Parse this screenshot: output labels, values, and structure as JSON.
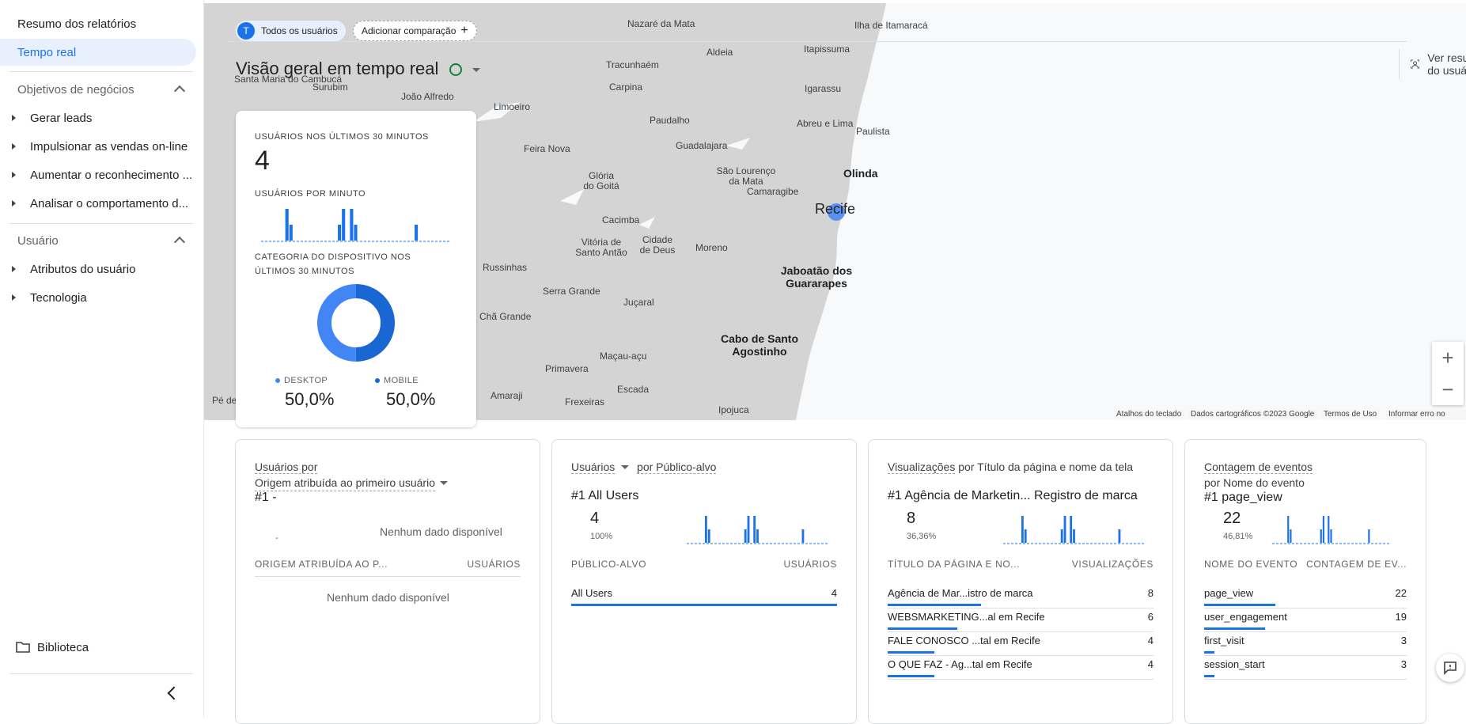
{
  "sidebar": {
    "summary": "Resumo dos relatórios",
    "realtime": "Tempo real",
    "section_business": "Objetivos de negócios",
    "business_items": [
      "Gerar leads",
      "Impulsionar as vendas on-line",
      "Aumentar o reconhecimento ...",
      "Analisar o comportamento d..."
    ],
    "section_user": "Usuário",
    "user_items": [
      "Atributos do usuário",
      "Tecnologia"
    ],
    "library": "Biblioteca"
  },
  "toolbar": {
    "all_users_avatar": "T",
    "all_users": "Todos os usuários",
    "add_comparison": "Adicionar comparação",
    "page_title": "Visão geral em tempo real",
    "user_summary": "Ver resumo do usuário"
  },
  "map": {
    "places": [
      "Ilha de Itamaracá",
      "Nazaré da Mata",
      "Aldeia",
      "Itapissuma",
      "Tracunhaém",
      "Igarassu",
      "Santa Maria do Cambucá",
      "Surubim",
      "João Alfredo",
      "Carpina",
      "Limoeiro",
      "Paudalho",
      "Abreu e Lima",
      "Paulista",
      "Feira Nova",
      "Guadalajara",
      "Olinda",
      "Glória do Goitá",
      "São Lourenço da Mata",
      "Camaragibe",
      "Recife",
      "Cacimba",
      "Vitória de Santo Antão",
      "Cidade de Deus",
      "Moreno",
      "Jaboatão dos Guararapes",
      "Russinhas",
      "Serra Grande",
      "Juçaral",
      "Chã Grande",
      "Cabo de Santo Agostinho",
      "Maçau-açu",
      "Primavera",
      "Escada",
      "Amaraji",
      "Frexeiras",
      "Ipojuca",
      "Pé de"
    ],
    "footer": [
      "Atalhos do teclado",
      "Dados cartográficos ©2023 Google",
      "Termos de Uso",
      "Informar erro no mapa"
    ],
    "zoom_in": "+",
    "zoom_out": "−"
  },
  "realtime_card": {
    "users_label": "USUÁRIOS NOS ÚLTIMOS 30 MINUTOS",
    "users_value": "4",
    "per_minute_label": "USUÁRIOS POR MINUTO",
    "per_minute_values": [
      0,
      0,
      0,
      0,
      0,
      0,
      1,
      0.5,
      0,
      0,
      0,
      0,
      0,
      0,
      0,
      0,
      0,
      0,
      0,
      0.5,
      1,
      0,
      1,
      0.5,
      0,
      0,
      0,
      0,
      0,
      0,
      0,
      0,
      0,
      0,
      0,
      0,
      0,
      0,
      0.5,
      0,
      0,
      0,
      0,
      0,
      0,
      0,
      0
    ],
    "device_label": "CATEGORIA DO DISPOSITIVO NOS ÚLTIMOS 30 MINUTOS",
    "device": [
      {
        "name": "DESKTOP",
        "value": "50,0%",
        "color": "#4285f4"
      },
      {
        "name": "MOBILE",
        "value": "50,0%",
        "color": "#1967d2"
      }
    ]
  },
  "cards": [
    {
      "title_1": "Usuários por",
      "title_2": "Origem atribuída ao primeiro usuário",
      "rank": "#1  -",
      "rank_value": "-",
      "no_data_1": "Nenhum dado disponível",
      "col_1": "ORIGEM ATRIBUÍDA AO P...",
      "col_2": "USUÁRIOS",
      "no_data_2": "Nenhum dado disponível"
    },
    {
      "title_1": "Usuários",
      "title_2": "por Público-alvo",
      "rank": "#1  All Users",
      "rank_value": "4",
      "rank_pct": "100%",
      "col_1": "PÚBLICO-ALVO",
      "col_2": "USUÁRIOS",
      "rows": [
        {
          "name": "All Users",
          "value": "4",
          "fraction": 1
        }
      ]
    },
    {
      "title_1": "Visualizações",
      "title_2": "por Título da página e nome da tela",
      "rank": "#1  Agência de Marketin... Registro de marca",
      "rank_value": "8",
      "rank_pct": "36,36%",
      "col_1": "TÍTULO DA PÁGINA E NO...",
      "col_2": "VISUALIZAÇÕES",
      "rows": [
        {
          "name": "Agência de Mar...istro de marca",
          "value": "8",
          "fraction": 1
        },
        {
          "name": "WEBSMARKETING...al em Recife",
          "value": "6",
          "fraction": 0.75
        },
        {
          "name": "FALE CONOSCO ...tal em Recife",
          "value": "4",
          "fraction": 0.5
        },
        {
          "name": "O QUE FAZ - Ag...tal em Recife",
          "value": "4",
          "fraction": 0.5
        }
      ]
    },
    {
      "title_1": "Contagem de eventos",
      "title_2": "por Nome do evento",
      "rank": "#1  page_view",
      "rank_value": "22",
      "rank_pct": "46,81%",
      "col_1": "NOME DO EVENTO",
      "col_2": "CONTAGEM DE EV...",
      "rows": [
        {
          "name": "page_view",
          "value": "22",
          "fraction": 1
        },
        {
          "name": "user_engagement",
          "value": "19",
          "fraction": 0.86
        },
        {
          "name": "first_visit",
          "value": "3",
          "fraction": 0.14
        },
        {
          "name": "session_start",
          "value": "3",
          "fraction": 0.14
        }
      ]
    }
  ]
}
